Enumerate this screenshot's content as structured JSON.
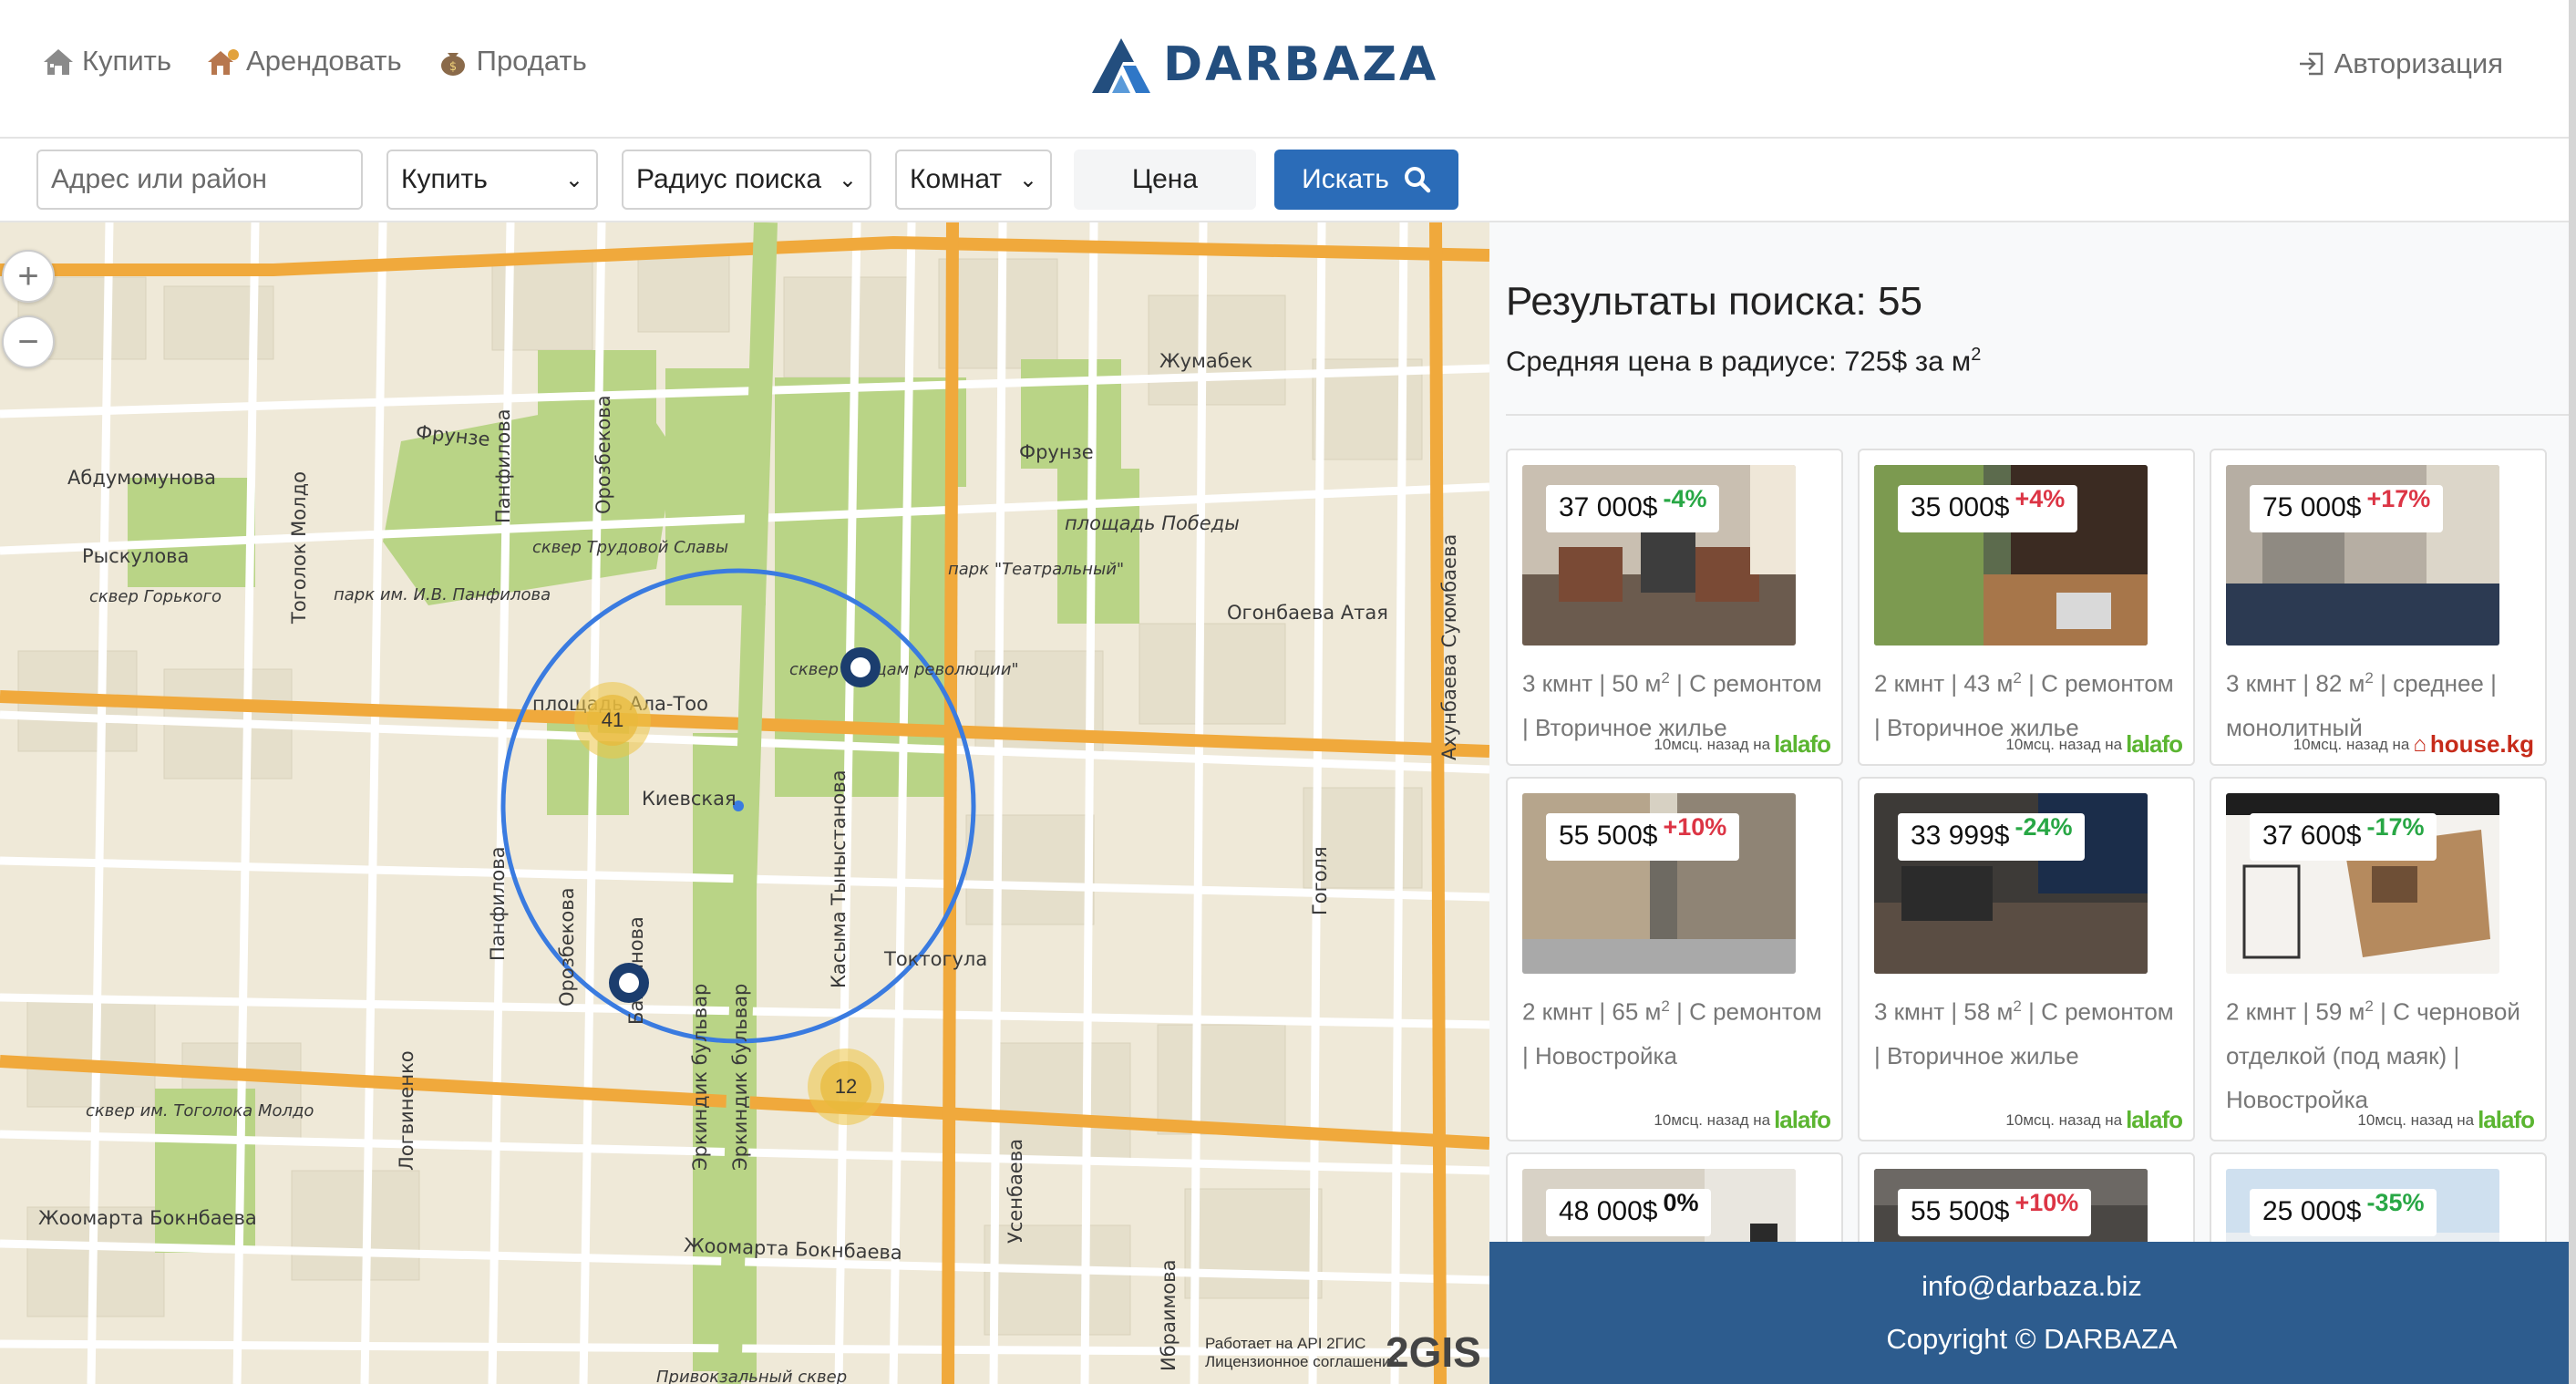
{
  "header": {
    "nav": [
      {
        "label": "Купить",
        "icon": "house-icon"
      },
      {
        "label": "Арендовать",
        "icon": "rent-house-icon"
      },
      {
        "label": "Продать",
        "icon": "money-bag-icon"
      }
    ],
    "logo": "DARBAZA",
    "auth_label": "Авторизация"
  },
  "search": {
    "address_placeholder": "Адрес или район",
    "deal_type": "Купить",
    "radius": "Радиус поиска",
    "rooms": "Комнат",
    "price_label": "Цена",
    "submit_label": "Искать"
  },
  "map": {
    "zoom_in": "+",
    "zoom_out": "−",
    "clusters": [
      {
        "count": "41"
      },
      {
        "count": "12"
      }
    ],
    "streets": [
      "Жумабек",
      "Фрунзе",
      "Фрунзе",
      "Абдумомунова",
      "Рыскулова",
      "Панфилова",
      "Орозбекова",
      "Тоголок Молдо",
      "площадь Ала-Тоо",
      "Киевская",
      "Панфилова",
      "Орозбекова",
      "Баялинова",
      "Эркиндик бульвар",
      "Эркиндик бульвар",
      "Касыма Тыныстанова",
      "Токтогула",
      "Огонбаева Атая",
      "Ахунбаева Суюмбаева",
      "Гоголя",
      "Логвиненко",
      "Жоомарта Бокнбаева",
      "Жоомарта Бокнбаева",
      "Усенбаева",
      "Ибраимова",
      "площадь Победы",
      "Привокзальный сквер"
    ],
    "parks": [
      "сквер Трудовой Славы",
      "парк им. И.В. Панфилова",
      "сквер Горького",
      "парк \"Театральный\"",
      "сквер Борцам революции\"",
      "сквер им. Тоголока Молдо"
    ],
    "attribution_line1": "Работает на API 2ГИС",
    "attribution_line2": "Лицензионное соглашение",
    "provider_logo": "2GIS"
  },
  "results": {
    "title": "Результаты поиска: 55",
    "avg_prefix": "Средняя цена в радиусе: 725$ за м",
    "avg_sup": "2",
    "listings": [
      {
        "price": "37 000$",
        "change": "-4%",
        "dir": "neg",
        "line1": "3 кмнт | 50 м",
        "line1_rest": " | С ремонтом",
        "line2": "| Вторичное жилье",
        "ago": "10мсц. назад на",
        "source": "lalafo"
      },
      {
        "price": "35 000$",
        "change": "+4%",
        "dir": "pos",
        "line1": "2 кмнт | 43 м",
        "line1_rest": " | С ремонтом",
        "line2": "| Вторичное жилье",
        "ago": "10мсц. назад на",
        "source": "lalafo"
      },
      {
        "price": "75 000$",
        "change": "+17%",
        "dir": "pos",
        "line1": "3 кмнт | 82 м",
        "line1_rest": " | среднее |",
        "line2": "монолитный",
        "ago": "10мсц. назад на",
        "source": "house.kg"
      },
      {
        "price": "55 500$",
        "change": "+10%",
        "dir": "pos",
        "line1": "2 кмнт | 65 м",
        "line1_rest": " | С ремонтом",
        "line2": "| Новостройка",
        "ago": "10мсц. назад на",
        "source": "lalafo"
      },
      {
        "price": "33 999$",
        "change": "-24%",
        "dir": "neg",
        "line1": "3 кмнт | 58 м",
        "line1_rest": " | С ремонтом",
        "line2": "| Вторичное жилье",
        "ago": "10мсц. назад на",
        "source": "lalafo"
      },
      {
        "price": "37 600$",
        "change": "-17%",
        "dir": "neg",
        "line1": "2 кмнт | 59 м",
        "line1_rest": " | С черновой",
        "line2": "отделкой (под маяк) |",
        "line3": "Новостройка",
        "ago": "10мсц. назад на",
        "source": "lalafo"
      },
      {
        "price": "48 000$",
        "change": "0%",
        "dir": "zero"
      },
      {
        "price": "55 500$",
        "change": "+10%",
        "dir": "pos"
      },
      {
        "price": "25 000$",
        "change": "-35%",
        "dir": "neg"
      }
    ]
  },
  "footer": {
    "email": "info@darbaza.biz",
    "copyright": "Copyright © DARBAZA"
  },
  "colors": {
    "brand": "#234e7e",
    "search_button": "#2b6cb8",
    "footer": "#2d5c8e",
    "price_up": "#dc3545",
    "price_down": "#28a745",
    "search_radius": "#3a7be0"
  }
}
